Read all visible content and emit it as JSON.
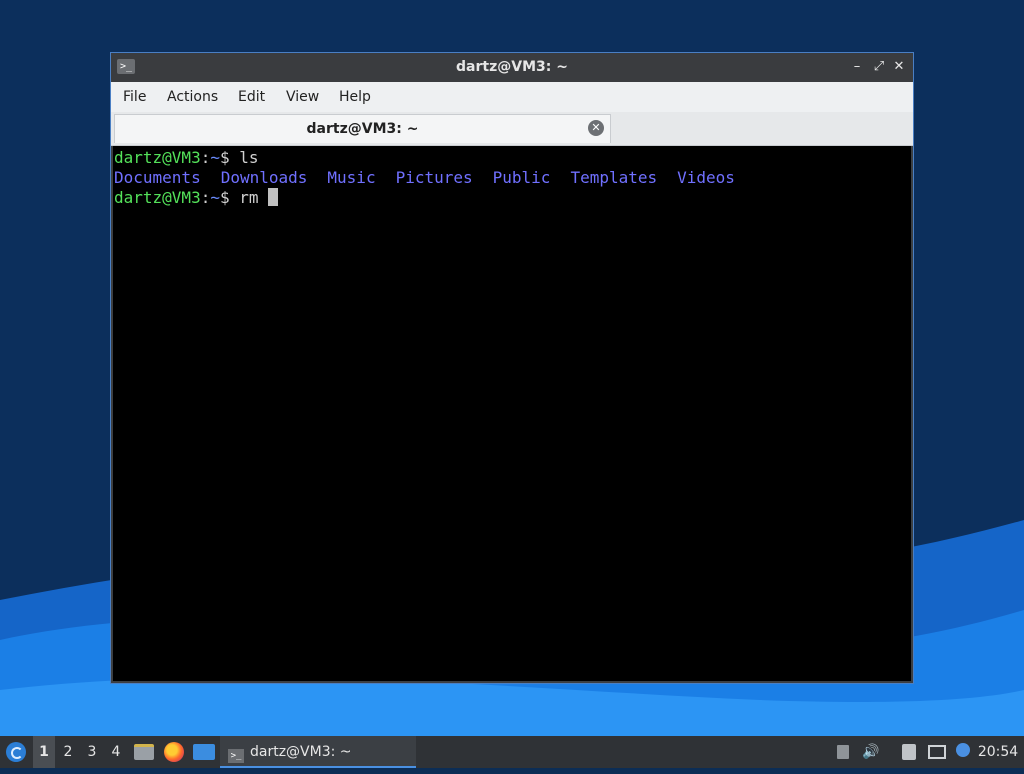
{
  "window": {
    "title": "dartz@VM3: ~",
    "controls": {
      "minimize": "–",
      "maximize": "⤢",
      "close": "✕"
    },
    "app_icon": ">_"
  },
  "menu": [
    "File",
    "Actions",
    "Edit",
    "View",
    "Help"
  ],
  "tab": {
    "title": "dartz@VM3: ~",
    "close_icon": "close-icon"
  },
  "terminal": {
    "prompt_user": "dartz@VM3",
    "prompt_sep": ":",
    "prompt_path": "~",
    "prompt_symbol": "$",
    "command1": " ls",
    "listing": [
      "Documents",
      "Downloads",
      "Music",
      "Pictures",
      "Public",
      "Templates",
      "Videos"
    ],
    "command2": " rm "
  },
  "taskbar": {
    "workspaces": [
      "1",
      "2",
      "3",
      "4"
    ],
    "active_workspace": "1",
    "task_label": "dartz@VM3: ~",
    "clock": "20:54",
    "launchers": [
      "file-manager-icon",
      "firefox-icon",
      "show-desktop-icon"
    ],
    "tray": [
      "updates-icon",
      "volume-icon",
      "clipboard-icon",
      "network-icon",
      "info-icon"
    ],
    "volume_glyph": "🔊"
  },
  "colors": {
    "prompt_green": "#54e25a",
    "directory_blue": "#7070ff",
    "terminal_bg": "#000000",
    "taskbar_bg": "#2f3236",
    "accent_blue": "#4a90e2"
  }
}
